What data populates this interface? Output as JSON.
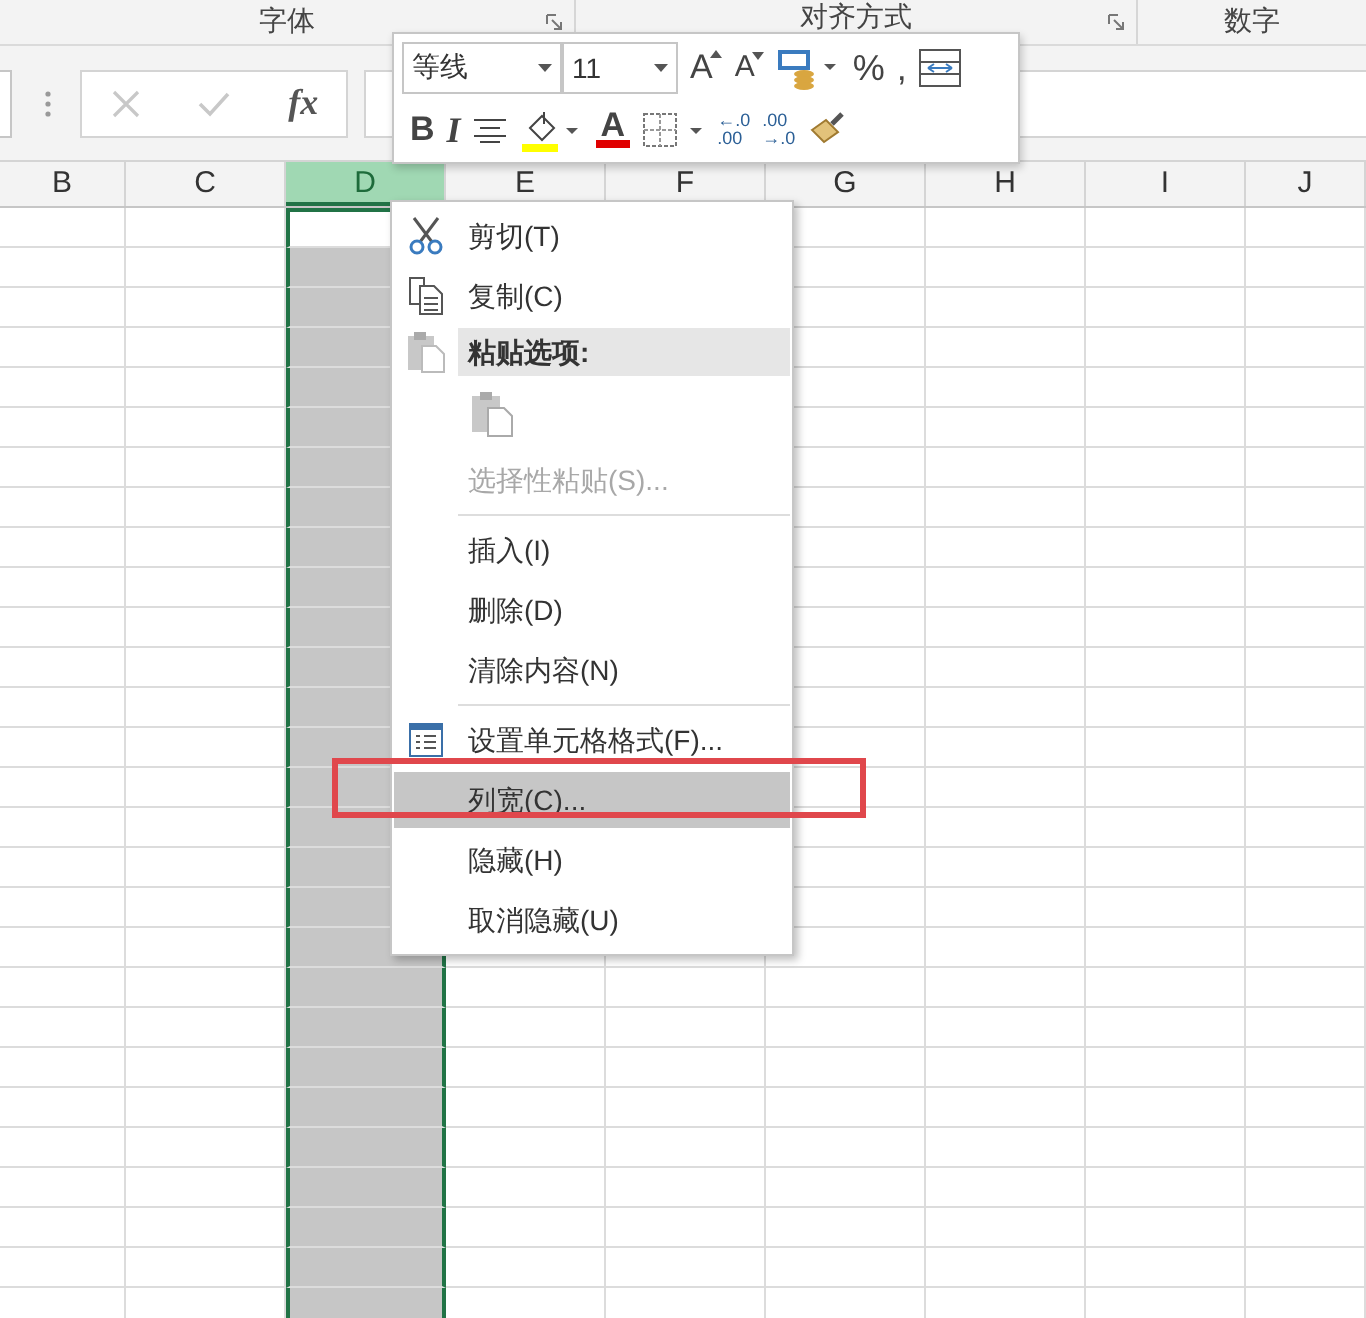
{
  "ribbon": {
    "groups": [
      {
        "label": "字体",
        "launcher": true
      },
      {
        "label": "对齐方式",
        "launcher": true
      },
      {
        "label": "数字",
        "launcher": false
      }
    ]
  },
  "formula_bar": {
    "fx": "fx",
    "cancel_disabled": true,
    "enter_disabled": true
  },
  "mini_toolbar": {
    "row1": [
      {
        "kind": "font-select",
        "value": "等线"
      },
      {
        "kind": "size-select",
        "value": "11"
      },
      {
        "kind": "grow-font",
        "glyph": "A"
      },
      {
        "kind": "shrink-font",
        "glyph": "A"
      },
      {
        "kind": "accounting"
      },
      {
        "kind": "text",
        "glyph": "%"
      },
      {
        "kind": "text",
        "glyph": ","
      },
      {
        "kind": "wrap"
      }
    ],
    "row2": [
      {
        "kind": "bold",
        "glyph": "B"
      },
      {
        "kind": "italic",
        "glyph": "I"
      },
      {
        "kind": "align-center"
      },
      {
        "kind": "fill-color",
        "color": "#ffff00"
      },
      {
        "kind": "font-color",
        "glyph": "A",
        "color": "#e00000"
      },
      {
        "kind": "borders"
      },
      {
        "kind": "decimal",
        "top": "←.0",
        "bottom": ".00"
      },
      {
        "kind": "decimal",
        "top": ".00",
        "bottom": "→.0"
      },
      {
        "kind": "painter"
      }
    ]
  },
  "columns": [
    {
      "label": "B",
      "selected": false
    },
    {
      "label": "C",
      "selected": false
    },
    {
      "label": "D",
      "selected": true
    },
    {
      "label": "E",
      "selected": false
    },
    {
      "label": "F",
      "selected": false
    },
    {
      "label": "G",
      "selected": false
    },
    {
      "label": "H",
      "selected": false
    },
    {
      "label": "I",
      "selected": false
    },
    {
      "label": "J",
      "selected": false
    }
  ],
  "context_menu": [
    {
      "kind": "cut",
      "label": "剪切(T)",
      "disabled": false,
      "selected": false
    },
    {
      "kind": "copy",
      "label": "复制(C)",
      "disabled": false,
      "selected": false
    },
    {
      "kind": "header",
      "label": "粘贴选项:"
    },
    {
      "kind": "paste-options"
    },
    {
      "kind": "plain",
      "label": "选择性粘贴(S)...",
      "disabled": true,
      "selected": false
    },
    {
      "kind": "separator"
    },
    {
      "kind": "plain",
      "label": "插入(I)",
      "disabled": false,
      "selected": false
    },
    {
      "kind": "plain",
      "label": "删除(D)",
      "disabled": false,
      "selected": false
    },
    {
      "kind": "plain",
      "label": "清除内容(N)",
      "disabled": false,
      "selected": false
    },
    {
      "kind": "separator"
    },
    {
      "kind": "format",
      "label": "设置单元格格式(F)...",
      "disabled": false,
      "selected": false
    },
    {
      "kind": "plain",
      "label": "列宽(C)...",
      "disabled": false,
      "selected": true
    },
    {
      "kind": "plain",
      "label": "隐藏(H)",
      "disabled": false,
      "selected": false
    },
    {
      "kind": "plain",
      "label": "取消隐藏(U)",
      "disabled": false,
      "selected": false
    }
  ]
}
